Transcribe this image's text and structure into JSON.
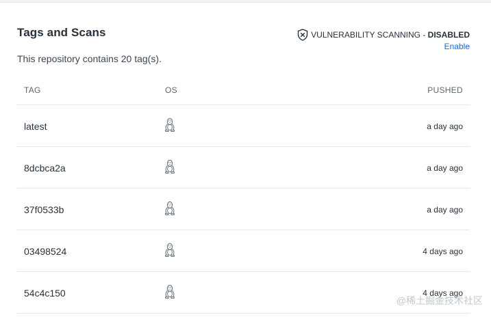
{
  "section": {
    "title": "Tags and Scans",
    "subtitle": "This repository contains 20 tag(s)."
  },
  "vulnerability": {
    "label": "VULNERABILITY SCANNING - ",
    "status": "DISABLED",
    "enable_label": "Enable",
    "icon": "shield-x-icon"
  },
  "table": {
    "columns": [
      "TAG",
      "OS",
      "PUSHED"
    ],
    "rows": [
      {
        "tag": "latest",
        "os": "linux-icon",
        "pushed": "a day ago"
      },
      {
        "tag": "8dcbca2a",
        "os": "linux-icon",
        "pushed": "a day ago"
      },
      {
        "tag": "37f0533b",
        "os": "linux-icon",
        "pushed": "a day ago"
      },
      {
        "tag": "03498524",
        "os": "linux-icon",
        "pushed": "4 days ago"
      },
      {
        "tag": "54c4c150",
        "os": "linux-icon",
        "pushed": "4 days ago"
      }
    ]
  },
  "watermark": "@稀土掘金技术社区",
  "colors": {
    "link": "#1d63ed",
    "text": "#27313b",
    "border": "#e6e9ec"
  }
}
